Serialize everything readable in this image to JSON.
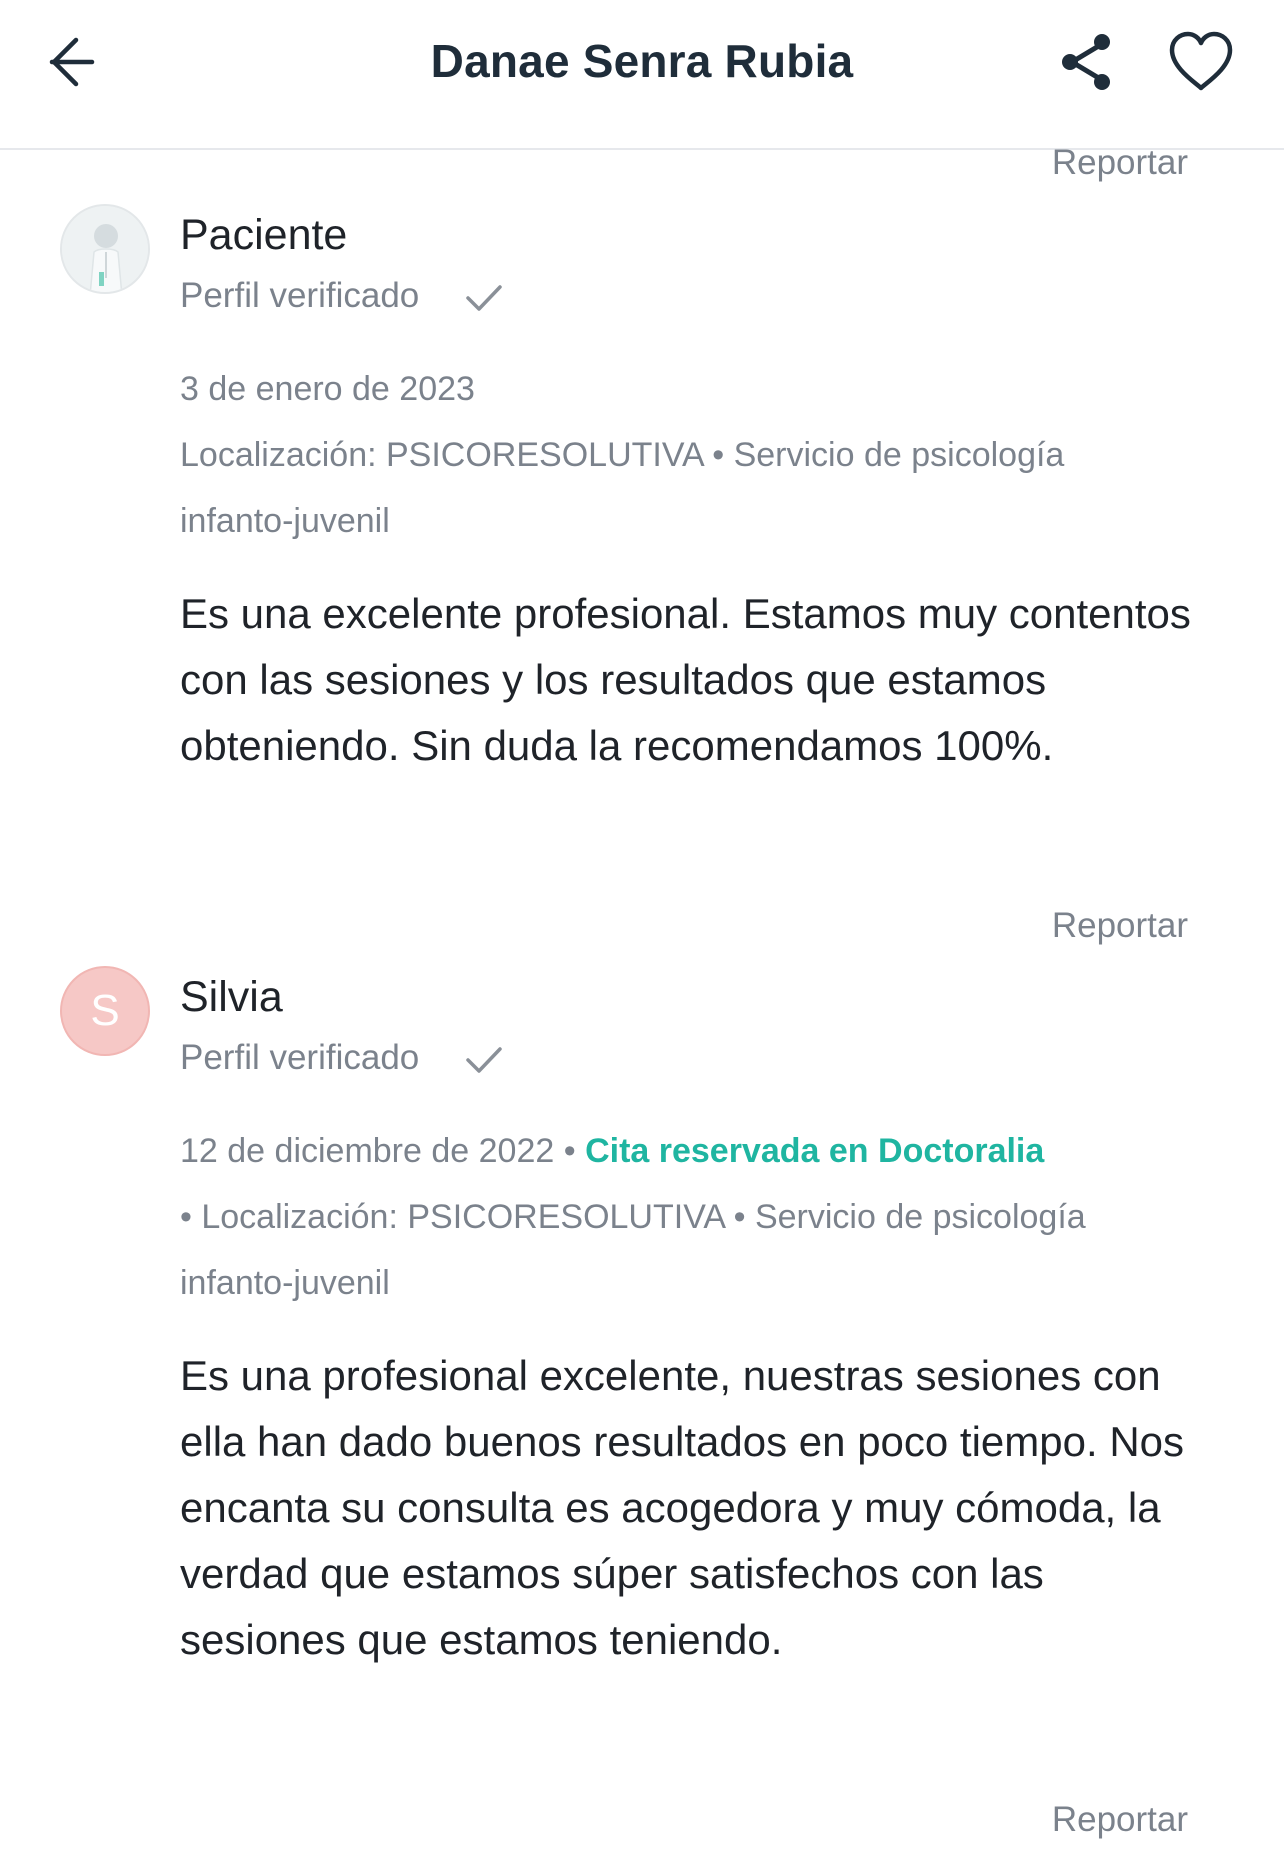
{
  "header": {
    "title": "Danae Senra Rubia"
  },
  "reviews": [
    {
      "report_label": "Reportar",
      "author": "Paciente",
      "verified_label": "Perfil verificado",
      "date": "3 de enero de 2023",
      "meta_line1": "Localización: PSICORESOLUTIVA • Servicio de psicología",
      "meta_line2": "infanto-juvenil",
      "text": "Es una excelente profesional. Estamos muy contentos con las sesiones y los resultados que estamos obteniendo. Sin duda la recomendamos 100%."
    },
    {
      "report_label": "Reportar",
      "author": "Silvia",
      "avatar_letter": "S",
      "verified_label": "Perfil verificado",
      "date": "12 de diciembre de 2022",
      "booked_label": "Cita reservada en Doctoralia",
      "meta_line1": "• Localización: PSICORESOLUTIVA • Servicio de psicología",
      "meta_line2": "infanto-juvenil",
      "text": "Es una profesional excelente, nuestras sesiones con ella han dado buenos resultados en poco tiempo. Nos encanta su consulta es acogedora y muy cómoda, la verdad que estamos súper satisfechos con las sesiones que estamos teniendo."
    }
  ],
  "footer_report_label": "Reportar",
  "colors": {
    "accent_green": "#1fb5a1",
    "muted_text": "#7b828c",
    "avatar_pink": "#f6c8c6"
  },
  "icons": [
    "arrow-left-icon",
    "share-icon",
    "heart-icon",
    "checkmark-icon"
  ]
}
